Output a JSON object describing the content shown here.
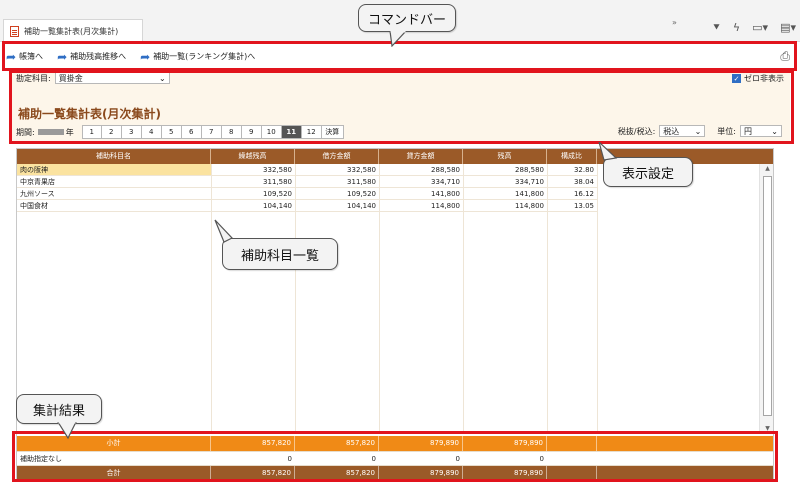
{
  "tab": {
    "title": "補助一覧集計表(月次集計)"
  },
  "toolbar_overflow": "»",
  "commands": [
    {
      "label": "帳簿へ"
    },
    {
      "label": "補助残高推移へ"
    },
    {
      "label": "補助一覧(ランキング集計)へ"
    }
  ],
  "filter": {
    "label": "勘定科目:",
    "value": "買掛金",
    "zero_hidden_label": "ゼロ非表示"
  },
  "page_title": "補助一覧集計表(月次集計)",
  "period": {
    "label": "期間:",
    "year_suffix": "年",
    "months": [
      "1",
      "2",
      "3",
      "4",
      "5",
      "6",
      "7",
      "8",
      "9",
      "10",
      "11",
      "12",
      "決算"
    ],
    "active_month": "11"
  },
  "tax": {
    "label": "税抜/税込:",
    "value": "税込"
  },
  "unit": {
    "label": "単位:",
    "value": "円"
  },
  "table": {
    "columns": [
      "補助科目名",
      "繰越残高",
      "借方金額",
      "貸方金額",
      "残高",
      "構成比"
    ],
    "rows": [
      {
        "name": "肉の阪神",
        "carry": "332,580",
        "debit": "332,580",
        "credit": "288,580",
        "balance": "288,580",
        "ratio": "32.80"
      },
      {
        "name": "中京青果店",
        "carry": "311,580",
        "debit": "311,580",
        "credit": "334,710",
        "balance": "334,710",
        "ratio": "38.04"
      },
      {
        "name": "九州ソース",
        "carry": "109,520",
        "debit": "109,520",
        "credit": "141,800",
        "balance": "141,800",
        "ratio": "16.12"
      },
      {
        "name": "中国食材",
        "carry": "104,140",
        "debit": "104,140",
        "credit": "114,800",
        "balance": "114,800",
        "ratio": "13.05"
      }
    ],
    "subtotal": {
      "name": "小計",
      "carry": "857,820",
      "debit": "857,820",
      "credit": "879,890",
      "balance": "879,890"
    },
    "unassigned": {
      "name": "補助指定なし",
      "carry": "0",
      "debit": "0",
      "credit": "0",
      "balance": "0"
    },
    "total": {
      "name": "合計",
      "carry": "857,820",
      "debit": "857,820",
      "credit": "879,890",
      "balance": "879,890"
    }
  },
  "callouts": {
    "command_bar": "コマンドバー",
    "display_settings": "表示設定",
    "sub_account_list": "補助科目一覧",
    "summary": "集計結果"
  },
  "colors": {
    "header": "#9b5a28",
    "subtotal": "#f08a16",
    "highlight": "#e1141d"
  }
}
